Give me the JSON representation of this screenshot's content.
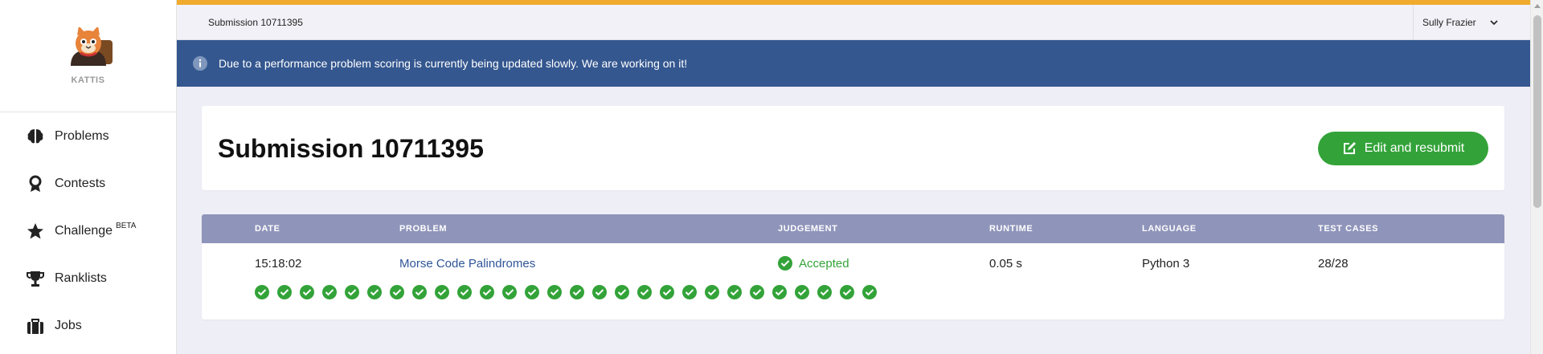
{
  "sidebar": {
    "logo_text": "KATTIS",
    "items": [
      {
        "label": "Problems",
        "icon": "brain-icon"
      },
      {
        "label": "Contests",
        "icon": "award-icon"
      },
      {
        "label": "Challenge",
        "icon": "star-icon",
        "badge": "BETA"
      },
      {
        "label": "Ranklists",
        "icon": "trophy-icon"
      },
      {
        "label": "Jobs",
        "icon": "briefcase-icon"
      }
    ]
  },
  "topbar": {
    "breadcrumb": "Submission 10711395",
    "user_name": "Sully Frazier"
  },
  "banner": {
    "message": "Due to a performance problem scoring is currently being updated slowly. We are working on it!"
  },
  "submission": {
    "title": "Submission 10711395",
    "resubmit_label": "Edit and resubmit"
  },
  "table": {
    "headers": [
      "DATE",
      "PROBLEM",
      "JUDGEMENT",
      "RUNTIME",
      "LANGUAGE",
      "TEST CASES"
    ],
    "row": {
      "date": "15:18:02",
      "problem": "Morse Code Palindromes",
      "judgement": "Accepted",
      "runtime": "0.05 s",
      "language": "Python 3",
      "test_cases": "28/28"
    },
    "test_case_count": 28,
    "test_cases_passed": 28
  },
  "colors": {
    "accent_stripe": "#f0ab2e",
    "banner": "#34578f",
    "accepted": "#33a339",
    "table_header": "#8f94ba",
    "link": "#2f5599"
  }
}
